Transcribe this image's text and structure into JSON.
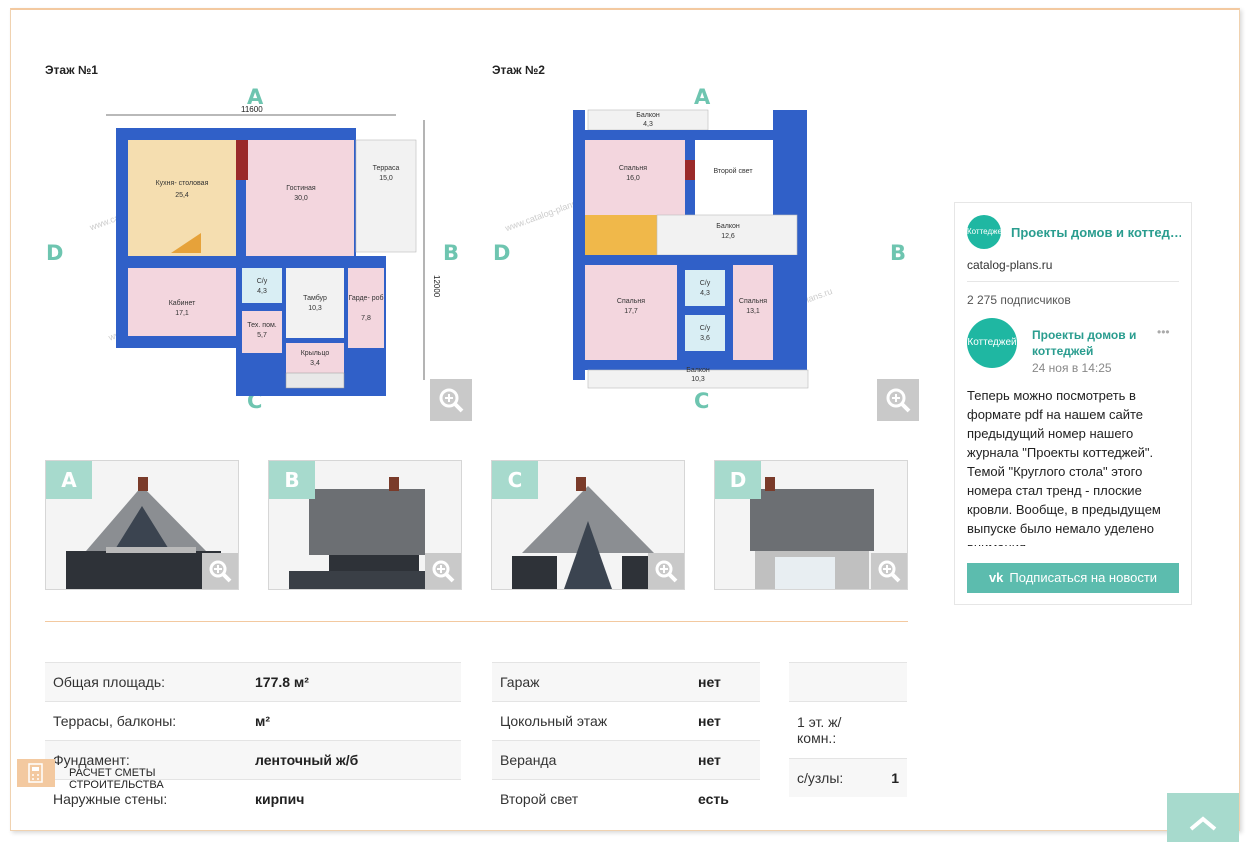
{
  "floors": [
    {
      "title": "Этаж №1",
      "dims": {
        "width": "11600",
        "height": "12000"
      },
      "sides": {
        "top": "A",
        "left": "D",
        "right": "B",
        "bottom": "C"
      },
      "rooms": [
        {
          "name": "Кухня-\nстоловая",
          "area": "25,4"
        },
        {
          "name": "Гостиная",
          "area": "30,0"
        },
        {
          "name": "Терраса",
          "area": "15,0"
        },
        {
          "name": "Кабинет",
          "area": "17,1"
        },
        {
          "name": "С/у",
          "area": "4,3"
        },
        {
          "name": "Тамбур",
          "area": "10,3"
        },
        {
          "name": "Гарде-\nроб",
          "area": "7,8"
        },
        {
          "name": "Тех. пом.",
          "area": "5,7"
        },
        {
          "name": "Крыльцо",
          "area": "3,4"
        }
      ]
    },
    {
      "title": "Этаж №2",
      "sides": {
        "top": "A",
        "left": "D",
        "right": "B",
        "bottom": "C"
      },
      "rooms": [
        {
          "name": "Балкон",
          "area": "4,3"
        },
        {
          "name": "Спальня",
          "area": "16,0"
        },
        {
          "name": "Второй\nсвет",
          "area": ""
        },
        {
          "name": "Балкон",
          "area": "12,6"
        },
        {
          "name": "Спальня",
          "area": "17,7"
        },
        {
          "name": "С/у",
          "area": "4,3"
        },
        {
          "name": "С/у",
          "area": "3,6"
        },
        {
          "name": "Спальня",
          "area": "13,1"
        },
        {
          "name": "Балкон",
          "area": "10,3"
        }
      ]
    }
  ],
  "watermark": "www.catalog-plans.ru",
  "facades": [
    "A",
    "B",
    "C",
    "D"
  ],
  "specs_left": [
    {
      "label": "Общая площадь:",
      "value": "177.8 м²"
    },
    {
      "label": "Террасы, балконы:",
      "value": "м²"
    },
    {
      "label": "Фундамент:",
      "value": "ленточный ж/б"
    },
    {
      "label": "Наружные стены:",
      "value": "кирпич"
    }
  ],
  "specs_mid": [
    {
      "label": "Гараж",
      "value": "нет"
    },
    {
      "label": "Цокольный этаж",
      "value": "нет"
    },
    {
      "label": "Веранда",
      "value": "нет"
    },
    {
      "label": "Второй свет",
      "value": "есть"
    }
  ],
  "specs_right": [
    {
      "label": "",
      "value": ""
    },
    {
      "label": "1 эт. ж/ комн.:",
      "value": ""
    },
    {
      "label": "с/узлы:",
      "value": "1"
    }
  ],
  "calc_label": "РАСЧЕТ СМЕТЫ СТРОИТЕЛЬСТВА",
  "widget": {
    "group_name": "Проекты домов и коттед…",
    "logo_text": "Коттеджей",
    "site": "catalog-plans.ru",
    "subscribers": "2 275 подписчиков",
    "post_author": "Проекты домов и коттеджей",
    "post_date": "24 ноя в 14:25",
    "post_text": "Теперь можно посмотреть в формате pdf на нашем сайте предыдущий номер нашего журнала \"Проекты коттеджей\". Темой \"Круглого стола\" этого номера стал тренд - плоские кровли. Вообще, в предыдущем выпуске было немало уделено внимания",
    "subscribe_button": "Подписаться на новости",
    "more_icon": "•••"
  },
  "colors": {
    "wall": "#1a5fc8",
    "accent": "#6ec5b0",
    "divider": "#f3c9a0"
  }
}
